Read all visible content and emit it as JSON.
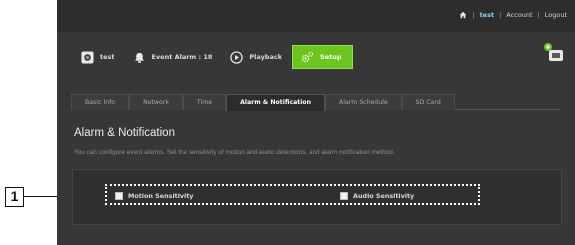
{
  "callout": {
    "number": "1"
  },
  "topbar": {
    "links": [
      {
        "label": "test"
      },
      {
        "label": "Account"
      },
      {
        "label": "Logout"
      }
    ],
    "separator": "|"
  },
  "menu": {
    "items": [
      {
        "label": "test",
        "icon": "camera-icon"
      },
      {
        "label": "Event Alarm : 18",
        "icon": "alarm-bell-icon"
      },
      {
        "label": "Playback",
        "icon": "play-icon"
      },
      {
        "label": "Setup",
        "icon": "gear-icon",
        "active": true
      }
    ]
  },
  "tabs": [
    {
      "label": "Basic Info"
    },
    {
      "label": "Network"
    },
    {
      "label": "Time"
    },
    {
      "label": "Alarm & Notification",
      "active": true
    },
    {
      "label": "Alarm Schedule"
    },
    {
      "label": "SD Card"
    }
  ],
  "section": {
    "title": "Alarm & Notification",
    "description": "You can configure event alarms. Set the sensitivity of motion and audio detections, and alarm notification method."
  },
  "options": [
    {
      "label": "Motion Sensitivity",
      "checked": false
    },
    {
      "label": "Audio Sensitivity",
      "checked": false
    }
  ],
  "colors": {
    "accent": "#6cc41e",
    "panel_bg": "#373737",
    "user_link": "#8fd0ff"
  }
}
